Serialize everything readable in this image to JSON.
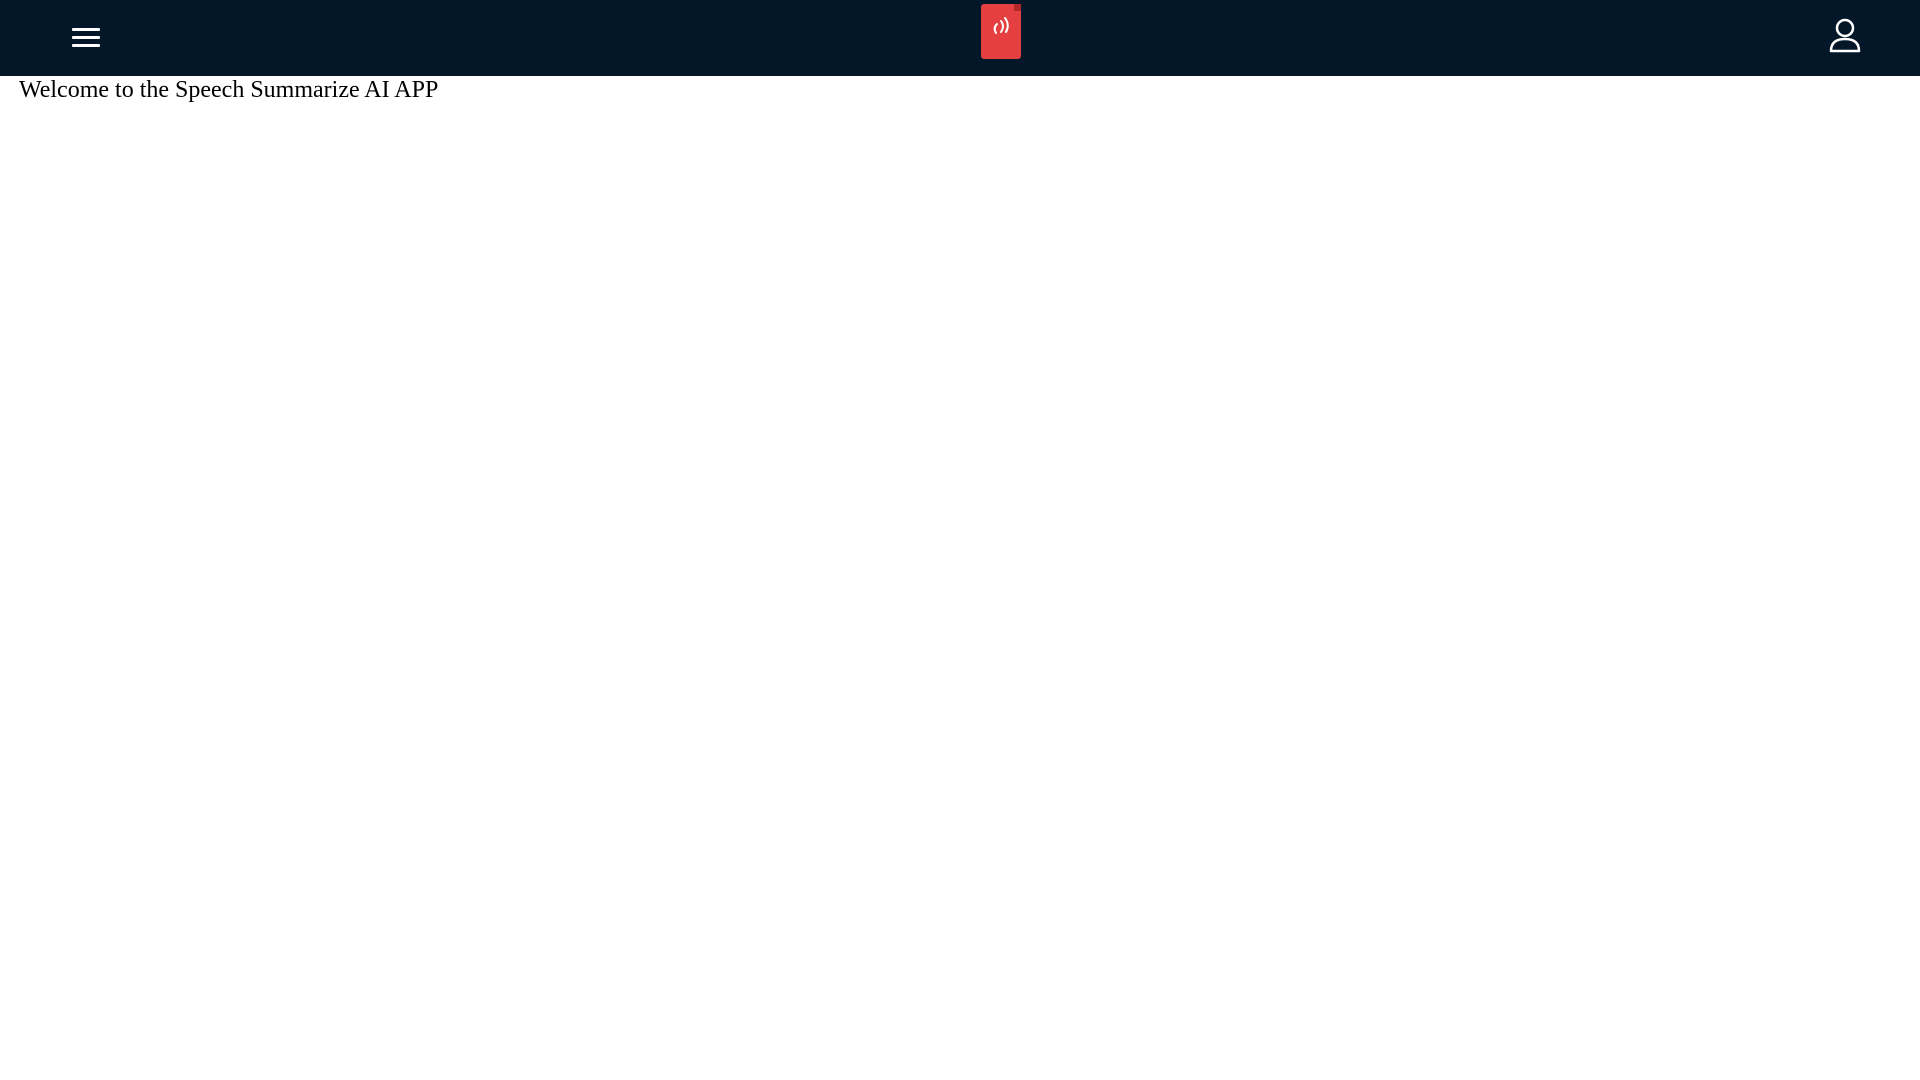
{
  "header": {
    "background_color": "#031729",
    "menu_icon": "hamburger-menu-icon",
    "logo_icon": "sound-waves-icon",
    "logo_color": "#e53f42",
    "profile_icon": "user-profile-icon"
  },
  "main": {
    "welcome_text": "Welcome to the Speech Summarize AI APP"
  }
}
